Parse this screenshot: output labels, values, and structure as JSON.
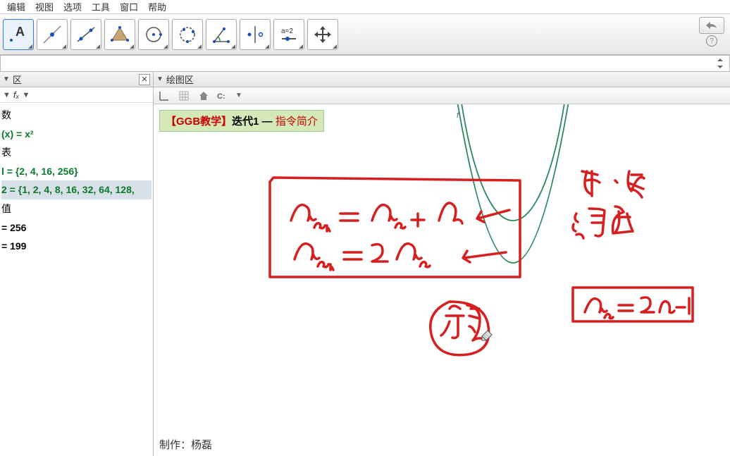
{
  "menu": {
    "edit": "编辑",
    "view": "视图",
    "options": "选项",
    "tools": "工具",
    "window": "窗口",
    "help": "帮助"
  },
  "leftPanel": {
    "title": "区",
    "fx": "fₓ",
    "rows": [
      {
        "html": "数",
        "cls": ""
      },
      {
        "html": "(x) = x²",
        "cls": "alg-green"
      },
      {
        "html": "表",
        "cls": ""
      },
      {
        "html": "l = {2, 4, 16, 256}",
        "cls": "alg-green"
      },
      {
        "html": "2 = {1, 2, 4, 8, 16, 32, 64, 128,",
        "cls": "alg-green alg-highlight"
      },
      {
        "html": "值",
        "cls": ""
      },
      {
        "html": " = 256",
        "cls": "alg-black"
      },
      {
        "html": " = 199",
        "cls": "alg-black"
      }
    ]
  },
  "rightPanel": {
    "title": "绘图区"
  },
  "canvas": {
    "titlePrefix": "【GGB教学】",
    "titleMid": "迭代1 — ",
    "titleSuffix": "指令简介",
    "curveLabel": "f",
    "footer": "制作：杨磊"
  },
  "formulas": {
    "eq1": "aₙ₊₁ = aₙ + d",
    "eq2": "aₙ₊₁ = 2aₙ",
    "eq3": "aₙ = 2n−1",
    "label1": "序列",
    "note1": "点·线",
    "note2": "涌形"
  }
}
